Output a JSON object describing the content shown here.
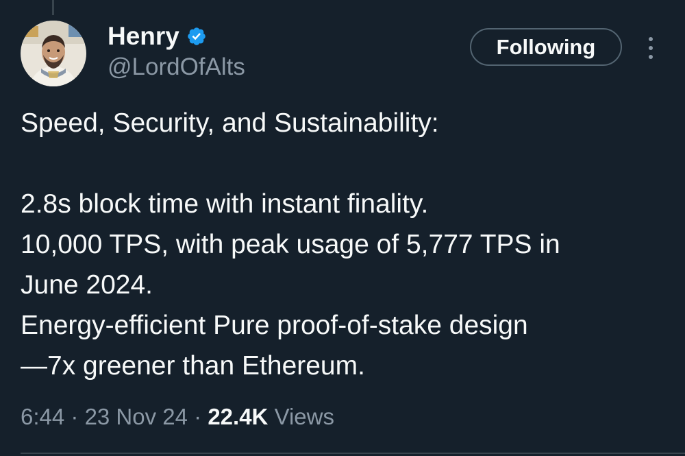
{
  "author": {
    "display_name": "Henry",
    "handle": "@LordOfAlts",
    "verified_icon": "verified-badge-icon",
    "avatar_icon": "profile-avatar"
  },
  "actions": {
    "follow_label": "Following",
    "more_icon": "more-vertical-icon"
  },
  "tweet": {
    "lines": [
      "Speed, Security, and Sustainability:",
      "",
      "2.8s block time with instant finality.",
      "10,000 TPS, with peak usage of 5,777 TPS in",
      "June 2024.",
      "Energy-efficient Pure proof-of-stake design",
      "—7x greener than Ethereum."
    ]
  },
  "meta": {
    "time": "6:44",
    "separator": " · ",
    "date": "23 Nov 24",
    "views_count": "22.4K",
    "views_label": "Views"
  },
  "colors": {
    "background": "#15202b",
    "text_primary": "#f7f9f9",
    "text_secondary": "#8b98a5",
    "verified": "#1d9bf0",
    "border": "#536471"
  }
}
